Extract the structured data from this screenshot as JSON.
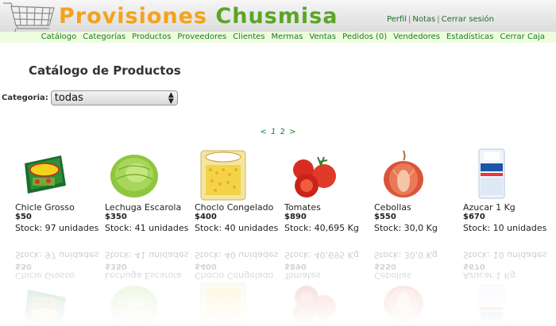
{
  "brand": {
    "name_part1": "Provisiones",
    "name_part2": "Chusmisa"
  },
  "top_links": [
    {
      "label": "Perfil"
    },
    {
      "label": "Notas"
    },
    {
      "label": "Cerrar sesión"
    }
  ],
  "top_links_separator": "|",
  "nav": {
    "items": [
      "Catálogo",
      "Categorías",
      "Productos",
      "Proveedores",
      "Clientes",
      "Mermas",
      "Ventas",
      "Pedidos (0)",
      "Vendedores",
      "Estadísticas",
      "Cerrar Caja"
    ]
  },
  "page_title": "Catálogo de Productos",
  "filter": {
    "label": "Categoria:",
    "selected": "todas"
  },
  "pagination": {
    "prev": "<",
    "pages": [
      "1",
      "2"
    ],
    "current": "1",
    "next": ">"
  },
  "colors": {
    "brand_orange": "#f5a21a",
    "brand_green": "#5aa526",
    "link_green": "#1f7a1f",
    "nav_bg": "#eefde0"
  },
  "products": [
    {
      "name": "Chicle Grosso",
      "price": "$50",
      "stock": "Stock: 97 unidades",
      "icon": "gum-pack-image"
    },
    {
      "name": "Lechuga Escarola",
      "price": "$350",
      "stock": "Stock: 41 unidades",
      "icon": "lettuce-image"
    },
    {
      "name": "Choclo Congelado",
      "price": "$400",
      "stock": "Stock: 40 unidades",
      "icon": "frozen-corn-bag-image"
    },
    {
      "name": "Tomates",
      "price": "$890",
      "stock": "Stock: 40,695 Kg",
      "icon": "tomatoes-image"
    },
    {
      "name": "Cebollas",
      "price": "$550",
      "stock": "Stock: 30,0 Kg",
      "icon": "onion-image"
    },
    {
      "name": "Azucar 1 Kg",
      "price": "$670",
      "stock": "Stock: 10 unidades",
      "icon": "sugar-bag-image"
    }
  ]
}
